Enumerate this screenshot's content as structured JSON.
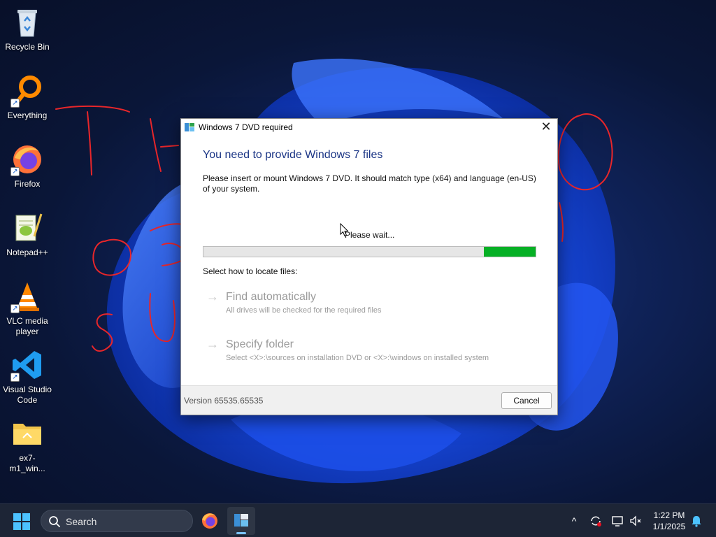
{
  "desktop": {
    "icons": [
      {
        "label": "Recycle Bin",
        "icon": "recycle-bin-icon"
      },
      {
        "label": "Everything",
        "icon": "everything-search-icon"
      },
      {
        "label": "Firefox",
        "icon": "firefox-icon"
      },
      {
        "label": "Notepad++",
        "icon": "notepad-plus-plus-icon"
      },
      {
        "label": "VLC media player",
        "icon": "vlc-icon"
      },
      {
        "label": "Visual Studio Code",
        "icon": "vscode-icon"
      },
      {
        "label": "ex7-m1_win...",
        "icon": "folder-icon"
      }
    ]
  },
  "dialog": {
    "title": "Windows 7 DVD required",
    "close_glyph": "✕",
    "heading": "You need to provide Windows 7 files",
    "description": "Please insert or mount Windows 7 DVD. It should match type (x64) and language (en-US) of your system.",
    "wait_text": "Please wait...",
    "progress": {
      "indeterminate": true,
      "indicator_start": 0.845,
      "indicator_fraction": 0.155,
      "color": "#06b025"
    },
    "locate_label": "Select how to locate files:",
    "options": [
      {
        "title": "Find automatically",
        "subtitle": "All drives will be checked for the required files"
      },
      {
        "title": "Specify folder",
        "subtitle": "Select <X>:\\sources on installation DVD or <X>:\\windows on installed system"
      }
    ],
    "version": "Version 65535.65535",
    "cancel_label": "Cancel",
    "heading_color": "#1b3585"
  },
  "taskbar": {
    "search_label": "Search",
    "clock_time": "1:22 PM",
    "clock_date": "1/1/2025",
    "tray": {
      "overflow_glyph": "^"
    }
  }
}
